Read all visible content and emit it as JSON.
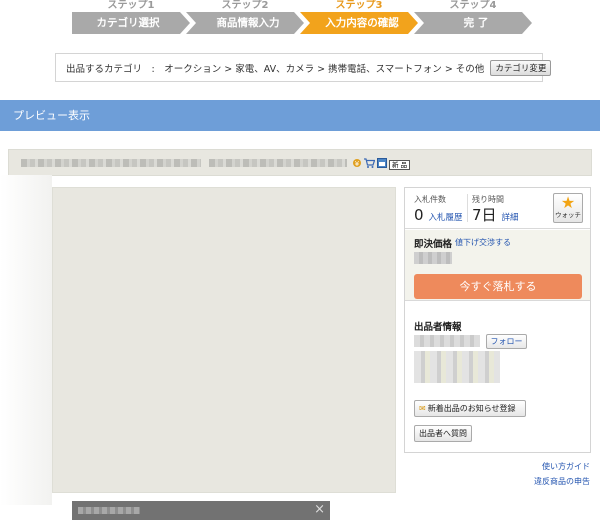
{
  "steps": [
    {
      "num": "ステップ1",
      "label": "カテゴリ選択",
      "active": false
    },
    {
      "num": "ステップ2",
      "label": "商品情報入力",
      "active": false
    },
    {
      "num": "ステップ3",
      "label": "入力内容の確認",
      "active": true
    },
    {
      "num": "ステップ4",
      "label": "完 了",
      "active": false
    }
  ],
  "category": {
    "text": "出品するカテゴリ　:　オークション > 家電、AV、カメラ > 携帯電話、スマートフォン > その他",
    "change_label": "カテゴリ変更"
  },
  "preview": {
    "title": "プレビュー表示"
  },
  "title_strip": {
    "new_badge": "新 品"
  },
  "auction": {
    "bids_label": "入札件数",
    "bids_count": "0",
    "bids_history": "入札履歴",
    "time_label": "残り時間",
    "time_value": "7日",
    "time_detail": "詳細",
    "watch_label": "ウォッチ"
  },
  "buy_now": {
    "title": "即決価格",
    "negotiate_link": "値下げ交渉する",
    "buy_button": "今すぐ落札する"
  },
  "seller": {
    "title": "出品者情報",
    "follow_button": "フォロー",
    "notify_button": "新着出品のお知らせ登録",
    "ask_button": "出品者へ質問"
  },
  "footer": {
    "help_link": "使い方ガイド",
    "report_link": "違反商品の申告"
  },
  "colors": {
    "step_inactive": "#a9a9a9",
    "step_active": "#f2a31c",
    "preview_bar": "#6e9ed8",
    "buy_button": "#ee8a5c",
    "link": "#2455b0"
  }
}
